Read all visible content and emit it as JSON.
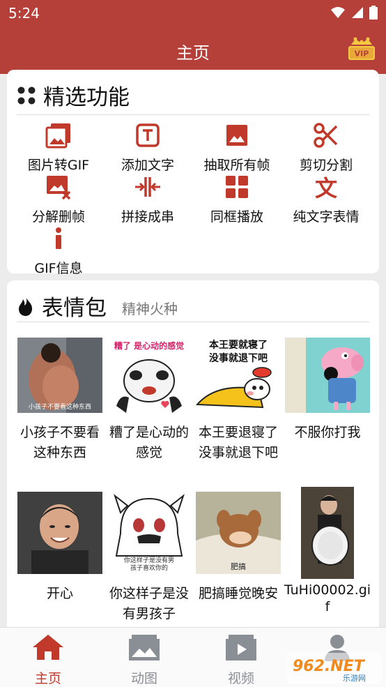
{
  "status": {
    "time": "5:24"
  },
  "appbar": {
    "title": "主页",
    "vip_label": "VIP"
  },
  "featured": {
    "title": "精选功能",
    "items": [
      {
        "label": "图片转GIF",
        "icon": "photo-stack-icon"
      },
      {
        "label": "添加文字",
        "icon": "text-box-icon"
      },
      {
        "label": "抽取所有帧",
        "icon": "image-icon"
      },
      {
        "label": "剪切分割",
        "icon": "scissors-icon"
      },
      {
        "label": "分解删帧",
        "icon": "image-delete-icon"
      },
      {
        "label": "拼接成串",
        "icon": "merge-icon"
      },
      {
        "label": "同框播放",
        "icon": "grid-icon"
      },
      {
        "label": "纯文字表情",
        "icon": "text-char-icon"
      },
      {
        "label": "GIF信息",
        "icon": "info-icon"
      }
    ]
  },
  "memes": {
    "title": "表情包",
    "subtitle": "精神火种",
    "items": [
      {
        "caption": "小孩子不要看这种东西",
        "overlay": "小孩子不要看这种东西"
      },
      {
        "caption": "糟了是心动的感觉",
        "overlay": "糟了 是心动的感觉"
      },
      {
        "caption": "本王要退寝了没事就退下吧",
        "overlay": "本王要就寝了\n没事就退下吧"
      },
      {
        "caption": "不服你打我",
        "overlay": ""
      },
      {
        "caption": "开心",
        "overlay": ""
      },
      {
        "caption": "你这样子是没有男孩子",
        "overlay": "你这样子是没有男孩子喜欢你的"
      },
      {
        "caption": "肥搞睡觉晚安",
        "overlay": "肥搞"
      },
      {
        "caption": "TuHi00002.gif",
        "overlay": ""
      }
    ]
  },
  "nav": {
    "items": [
      {
        "label": "主页",
        "icon": "home-icon",
        "active": true
      },
      {
        "label": "动图",
        "icon": "gallery-icon",
        "active": false
      },
      {
        "label": "视频",
        "icon": "video-icon",
        "active": false
      },
      {
        "label": "",
        "icon": "profile-icon",
        "active": false
      }
    ]
  },
  "watermark": {
    "text": "962.NET",
    "sub": "乐游网"
  },
  "colors": {
    "primary": "#b5403a",
    "accent": "#c0392b"
  }
}
